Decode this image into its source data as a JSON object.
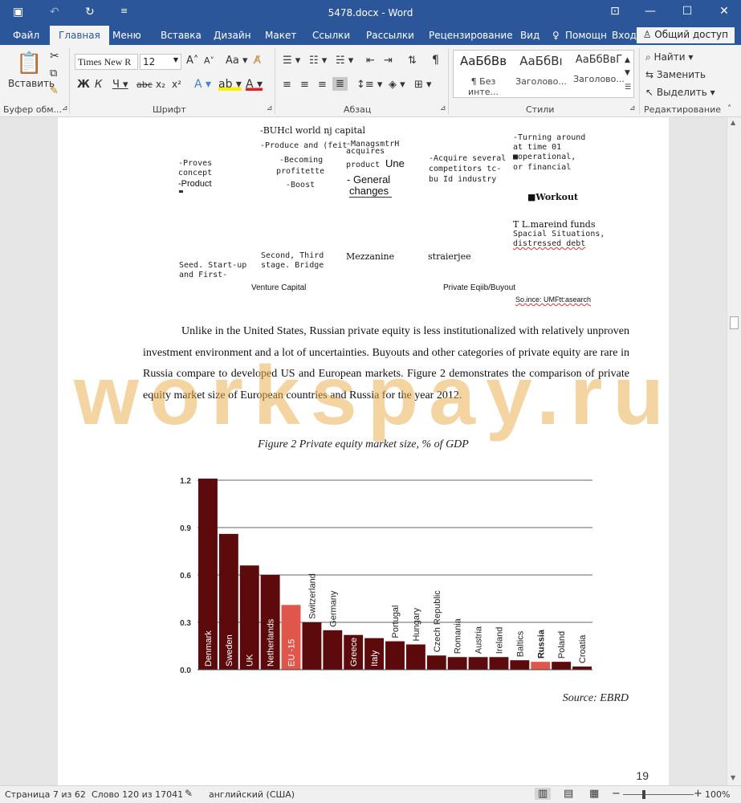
{
  "window": {
    "title": "5478.docx - Word"
  },
  "tabs": [
    {
      "label": "Файл"
    },
    {
      "label": "Главная"
    },
    {
      "label": "Меню"
    },
    {
      "label": "Вставка"
    },
    {
      "label": "Дизайн"
    },
    {
      "label": "Макет"
    },
    {
      "label": "Ссылки"
    },
    {
      "label": "Рассылки"
    },
    {
      "label": "Рецензирование"
    },
    {
      "label": "Вид"
    },
    {
      "label": "Помощн"
    },
    {
      "label": "Вход"
    }
  ],
  "share_label": "Общий доступ",
  "ribbon": {
    "paste_label": "Вставить",
    "font_name": "Times New R",
    "font_size": "12",
    "groups": {
      "clipboard": "Буфер обм...",
      "font": "Шрифт",
      "paragraph": "Абзац",
      "styles": "Стили",
      "editing": "Редактирование"
    },
    "styles": [
      {
        "sample": "АаБбВв",
        "name": "¶ Без инте..."
      },
      {
        "sample": "АаБбВı",
        "name": "Заголово..."
      },
      {
        "sample": "АаБбВвГ",
        "name": "Заголово..."
      }
    ],
    "editing": {
      "find": "Найти",
      "replace": "Заменить",
      "select": "Выделить"
    }
  },
  "diagram": {
    "t1": "-BUHcl world nj capital",
    "t2": "-Produce and (feit",
    "t3a": "-ManagsmtrH",
    "t3b": "acquires",
    "t3c": "product",
    "t3d": "Une",
    "t4a": "- General",
    "t4b": "changes",
    "t5a": "-Proves",
    "t5b": "concept",
    "t5c": "-Product",
    "t6a": "-Becoming",
    "t6b": "profitette",
    "t7": "-Boost",
    "t8a": "-Acquire several",
    "t8b": "competitors tc-",
    "t8c": "bu Id industry",
    "t9a": "-Turning around",
    "t9b": "at time 01",
    "t9c": "■operational,",
    "t9d": "or financial",
    "t10": "■Workout",
    "t11a": "T L.mareind funds",
    "t11b": "Spacial Situations,",
    "t11c": "distressed debt",
    "t12a": "Second, Third",
    "t12b": "stage. Bridge",
    "t13": "Mezzanine",
    "t14": "straierjee",
    "t15a": "Seed. Start-up",
    "t15b": "and First-",
    "t16": "Venture Capital",
    "t17": "Private Eqiib/Buyout",
    "t18": "So.ince: UMFtt:asearch"
  },
  "body_text": "Unlike in the United States, Russian private equity is less institutionalized with relatively unproven investment environment and a lot of uncertainties. Buyouts and other categories of private equity are rare in Russia compare to developed US and European markets. Figure 2 demonstrates the comparison of private equity market size of European countries and Russia for the year 2012.",
  "figure_caption": "Figure 2 Private equity market size, % of GDP",
  "source_caption": "Source: EBRD",
  "page_number": "19",
  "watermark": "workspay.ru",
  "chart_data": {
    "type": "bar",
    "title": "",
    "xlabel": "",
    "ylabel": "",
    "ylim": [
      0,
      1.2
    ],
    "yticks": [
      "0.0",
      "0.3",
      "0.6",
      "0.9",
      "1.2"
    ],
    "grid": true,
    "categories": [
      "Denmark",
      "Sweden",
      "UK",
      "Netherlands",
      "EU -15",
      "Switzerland",
      "Germany",
      "Greece",
      "Italy",
      "Portugal",
      "Hungary",
      "Czech Republic",
      "Romania",
      "Austria",
      "Ireland",
      "Baltics",
      "Russia",
      "Poland",
      "Croatia"
    ],
    "values": [
      1.21,
      0.86,
      0.66,
      0.6,
      0.41,
      0.3,
      0.25,
      0.22,
      0.2,
      0.18,
      0.16,
      0.09,
      0.08,
      0.08,
      0.08,
      0.06,
      0.05,
      0.05,
      0.02
    ],
    "colors": {
      "default": "#5c0a0c",
      "highlight": "#e0564a"
    },
    "highlight": [
      "EU -15",
      "Russia"
    ]
  },
  "status": {
    "page": "Страница 7 из 62",
    "words": "Слово 120 из 17041",
    "lang": "английский (США)",
    "zoom": "100%"
  }
}
